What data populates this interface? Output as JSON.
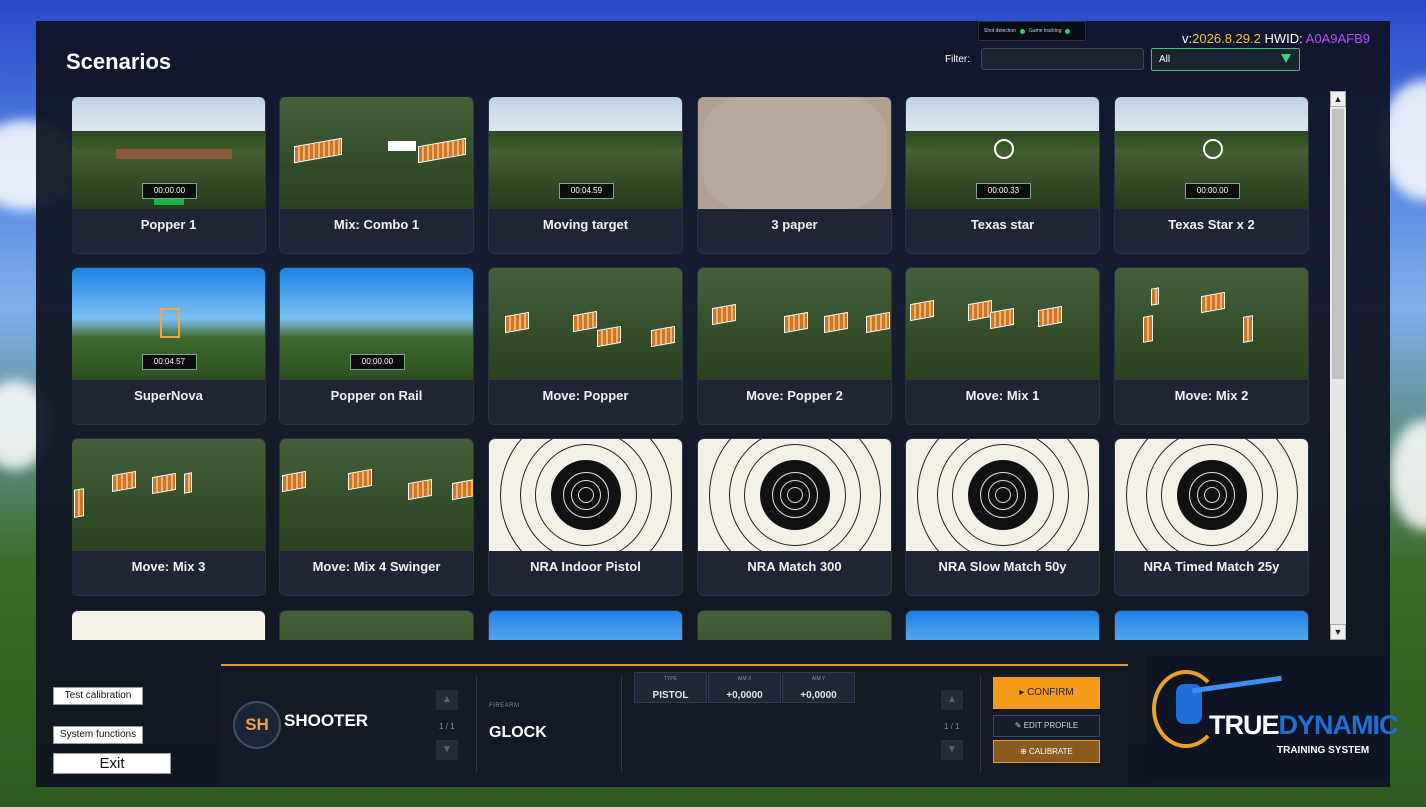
{
  "window": {
    "title": "Scenarios"
  },
  "status": {
    "items": [
      "Shot detection",
      "Game tracking"
    ]
  },
  "version": {
    "prefix": "v:",
    "number": "2026.8.29.2",
    "hwid_label": "HWID:",
    "hwid": "A0A9AFB9"
  },
  "filter": {
    "label": "Filter:",
    "value": "",
    "select_value": "All"
  },
  "scenarios": [
    {
      "label": "Popper 1",
      "timer": "00:00.00"
    },
    {
      "label": "Mix: Combo 1"
    },
    {
      "label": "Moving target",
      "timer": "00:04.59"
    },
    {
      "label": "3 paper"
    },
    {
      "label": "Texas star",
      "timer": "00:00.33"
    },
    {
      "label": "Texas Star x 2",
      "timer": "00:00.00"
    },
    {
      "label": "SuperNova",
      "timer": "00:04.57"
    },
    {
      "label": "Popper on Rail",
      "timer": "00:00.00"
    },
    {
      "label": "Move: Popper"
    },
    {
      "label": "Move: Popper 2"
    },
    {
      "label": "Move: Mix 1"
    },
    {
      "label": "Move: Mix 2"
    },
    {
      "label": "Move: Mix 3"
    },
    {
      "label": "Move: Mix 4 Swinger"
    },
    {
      "label": "NRA Indoor Pistol"
    },
    {
      "label": "NRA Match 300"
    },
    {
      "label": "NRA Slow Match 50y"
    },
    {
      "label": "NRA Timed Match 25y"
    }
  ],
  "side": {
    "test_calibration": "Test calibration",
    "system_functions": "System functions",
    "exit": "Exit"
  },
  "profile": {
    "initials": "SH",
    "name": "SHOOTER",
    "page": "1 / 1",
    "firearm_label": "FIREARM",
    "firearm": "GLOCK",
    "stats": [
      {
        "label": "TYPE",
        "value": "PISTOL"
      },
      {
        "label": "AIM X",
        "value": "+0,0000"
      },
      {
        "label": "AIM Y",
        "value": "+0,0000"
      }
    ],
    "page2": "1 / 1",
    "confirm": "CONFIRM",
    "edit": "EDIT PROFILE",
    "calibrate": "CALIBRATE"
  },
  "logo": {
    "brand_true": "TRUE",
    "brand_dynamic": "DYNAMIC",
    "tagline": "TRAINING SYSTEM"
  }
}
